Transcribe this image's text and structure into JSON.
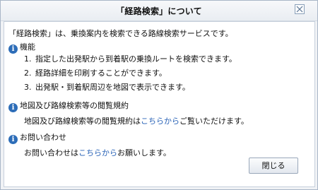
{
  "dialog": {
    "title": "「経路検索」について",
    "intro": "「経路検索」は、乗換案内を検索できる路線検索サービスです。"
  },
  "sections": {
    "features": {
      "heading": "機能",
      "items": [
        {
          "num": "1.",
          "text": "指定した出発駅から到着駅の乗換ルートを検索できます。"
        },
        {
          "num": "2.",
          "text": "経路詳細を印刷することができます。"
        },
        {
          "num": "3.",
          "text": "出発駅・到着駅周辺を地図で表示できます。"
        }
      ]
    },
    "terms": {
      "heading": "地図及び路線検索等の閲覧規約",
      "text_before": "地図及び路線検索等の閲覧規約は",
      "link": "こちらから",
      "text_after": "ご覧いただけます。"
    },
    "contact": {
      "heading": "お問い合わせ",
      "text_before": "お問い合わせは",
      "link": "こちらから",
      "text_after": "お願いします。"
    }
  },
  "buttons": {
    "close_label": "閉じる"
  },
  "icons": {
    "info": "info-icon",
    "close": "close-icon"
  }
}
